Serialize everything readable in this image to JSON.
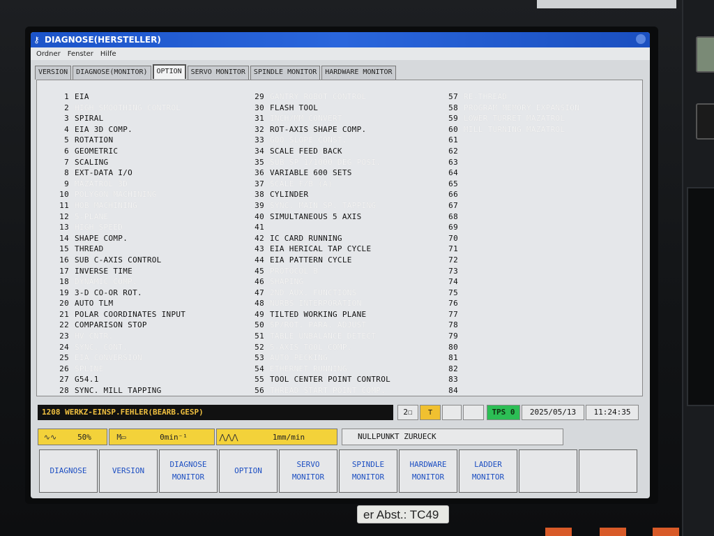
{
  "window": {
    "title": "DIAGNOSE(HERSTELLER)",
    "menu": [
      "Ordner",
      "Fenster",
      "Hilfe"
    ]
  },
  "tabs": [
    {
      "label": "VERSION",
      "active": false
    },
    {
      "label": "DIAGNOSE(MONITOR)",
      "active": false
    },
    {
      "label": "OPTION",
      "active": true
    },
    {
      "label": "SERVO MONITOR",
      "active": false
    },
    {
      "label": "SPINDLE MONITOR",
      "active": false
    },
    {
      "label": "HARDWARE MONITOR",
      "active": false
    }
  ],
  "options": {
    "col1": [
      {
        "n": "1",
        "name": "EIA",
        "on": true
      },
      {
        "n": "2",
        "name": "HIGH SMOOTHING CONTROL",
        "on": false
      },
      {
        "n": "3",
        "name": "SPIRAL",
        "on": true
      },
      {
        "n": "4",
        "name": "EIA 3D COMP.",
        "on": true
      },
      {
        "n": "5",
        "name": "ROTATION",
        "on": true
      },
      {
        "n": "6",
        "name": "GEOMETRIC",
        "on": true
      },
      {
        "n": "7",
        "name": "SCALING",
        "on": true
      },
      {
        "n": "8",
        "name": "EXT-DATA I/O",
        "on": true
      },
      {
        "n": "9",
        "name": "MAZATROL 3D",
        "on": false
      },
      {
        "n": "10",
        "name": "POLYGON MACHINING",
        "on": false
      },
      {
        "n": "11",
        "name": "HOB MACHINING",
        "on": false
      },
      {
        "n": "12",
        "name": "5-PLANE",
        "on": false
      },
      {
        "n": "13",
        "name": "HIGH SPEED",
        "on": false
      },
      {
        "n": "14",
        "name": "SHAPE COMP.",
        "on": true
      },
      {
        "n": "15",
        "name": "THREAD",
        "on": true
      },
      {
        "n": "16",
        "name": "SUB C-AXIS CONTROL",
        "on": true
      },
      {
        "n": "17",
        "name": "INVERSE TIME",
        "on": true
      },
      {
        "n": "18",
        "name": "DYNAMIC COMP.",
        "on": false
      },
      {
        "n": "19",
        "name": "3-D CO-OR ROT.",
        "on": true
      },
      {
        "n": "20",
        "name": "AUTO TLM",
        "on": true
      },
      {
        "n": "21",
        "name": "POLAR COORDINATES INPUT",
        "on": true
      },
      {
        "n": "22",
        "name": "COMPARISON STOP",
        "on": true
      },
      {
        "n": "23",
        "name": "HV CNTR.",
        "on": false
      },
      {
        "n": "24",
        "name": "SYNC. CONT.",
        "on": false
      },
      {
        "n": "25",
        "name": "EIA CONVERSION",
        "on": false
      },
      {
        "n": "26",
        "name": "SPLINE",
        "on": false
      },
      {
        "n": "27",
        "name": "G54.1",
        "on": true
      },
      {
        "n": "28",
        "name": "SYNC. MILL TAPPING",
        "on": true
      }
    ],
    "col2": [
      {
        "n": "29",
        "name": "GANTRY ROBOT CONTROL",
        "on": false
      },
      {
        "n": "30",
        "name": "FLASH TOOL",
        "on": true
      },
      {
        "n": "31",
        "name": "INCH/MM CONVERT",
        "on": false
      },
      {
        "n": "32",
        "name": "ROT-AXIS SHAPE COMP.",
        "on": true
      },
      {
        "n": "33",
        "name": "G00 SLOPE CONST.",
        "on": false
      },
      {
        "n": "34",
        "name": "SCALE FEED BACK",
        "on": true
      },
      {
        "n": "35",
        "name": "SUB SP 1/1000 DEG POSI.",
        "on": false
      },
      {
        "n": "36",
        "name": "VARIABLE 600 SETS",
        "on": true
      },
      {
        "n": "37",
        "name": "SCALE F/B (A)",
        "on": false
      },
      {
        "n": "38",
        "name": "CYLINDER",
        "on": true
      },
      {
        "n": "39",
        "name": "SYNC. MAIN SP. TAPPING",
        "on": false
      },
      {
        "n": "40",
        "name": "SIMULTANEOUS 5 AXIS",
        "on": true
      },
      {
        "n": "41",
        "name": "",
        "on": true
      },
      {
        "n": "42",
        "name": "IC CARD RUNNING",
        "on": true
      },
      {
        "n": "43",
        "name": "EIA HERICAL TAP CYCLE",
        "on": true
      },
      {
        "n": "44",
        "name": "EIA PATTERN CYCLE",
        "on": true
      },
      {
        "n": "45",
        "name": "PROTOCOL B",
        "on": false
      },
      {
        "n": "46",
        "name": "SHAPING",
        "on": false
      },
      {
        "n": "47",
        "name": "2ND AUX. FUNCTIONS",
        "on": false
      },
      {
        "n": "48",
        "name": "NURBS INTERPORATION",
        "on": false
      },
      {
        "n": "49",
        "name": "TILTED WORKING PLANE",
        "on": true
      },
      {
        "n": "50",
        "name": "SP/ROT. PARA. ADJUST",
        "on": false
      },
      {
        "n": "51",
        "name": "TABLE UNBALANCE DETECT",
        "on": false
      },
      {
        "n": "52",
        "name": "5-AXIS TOOL COMP.",
        "on": false
      },
      {
        "n": "53",
        "name": "AUTO PECKING",
        "on": false
      },
      {
        "n": "54",
        "name": "ETHERNET RUNNING",
        "on": false
      },
      {
        "n": "55",
        "name": "TOOL CENTER POINT CONTROL",
        "on": true
      },
      {
        "n": "56",
        "name": "THREAD START POINT COMP.",
        "on": false
      }
    ],
    "col3": [
      {
        "n": "57",
        "name": "RE-THREAD",
        "on": false
      },
      {
        "n": "58",
        "name": "PROGRAM MEMORY EXPANSION",
        "on": false
      },
      {
        "n": "59",
        "name": "LOWER TURRET MAZATROL",
        "on": false
      },
      {
        "n": "60",
        "name": "MILL TURNING MAZATROL",
        "on": false
      },
      {
        "n": "61",
        "name": "",
        "on": true
      },
      {
        "n": "62",
        "name": "",
        "on": true
      },
      {
        "n": "63",
        "name": "",
        "on": true
      },
      {
        "n": "64",
        "name": "",
        "on": true
      },
      {
        "n": "65",
        "name": "",
        "on": true
      },
      {
        "n": "66",
        "name": "",
        "on": true
      },
      {
        "n": "67",
        "name": "",
        "on": true
      },
      {
        "n": "68",
        "name": "",
        "on": true
      },
      {
        "n": "69",
        "name": "",
        "on": true
      },
      {
        "n": "70",
        "name": "",
        "on": true
      },
      {
        "n": "71",
        "name": "",
        "on": true
      },
      {
        "n": "72",
        "name": "",
        "on": true
      },
      {
        "n": "73",
        "name": "",
        "on": true
      },
      {
        "n": "74",
        "name": "",
        "on": true
      },
      {
        "n": "75",
        "name": "",
        "on": true
      },
      {
        "n": "76",
        "name": "",
        "on": true
      },
      {
        "n": "77",
        "name": "",
        "on": true
      },
      {
        "n": "78",
        "name": "",
        "on": true
      },
      {
        "n": "79",
        "name": "",
        "on": true
      },
      {
        "n": "80",
        "name": "",
        "on": true
      },
      {
        "n": "81",
        "name": "",
        "on": true
      },
      {
        "n": "82",
        "name": "",
        "on": true
      },
      {
        "n": "83",
        "name": "",
        "on": true
      },
      {
        "n": "84",
        "name": "",
        "on": true
      }
    ]
  },
  "status": {
    "alarm": "1208 WERKZ-EINSP.FEHLER(BEARB.GESP)",
    "icon1": "2☐",
    "tps": "TPS 0",
    "date": "2025/05/13",
    "time": "11:24:35",
    "spindle_override": "50%",
    "spindle_speed": "0min⁻¹",
    "feed": "1mm/min",
    "message": "NULLPUNKT ZURUECK"
  },
  "softkeys": [
    [
      "DIAGNOSE"
    ],
    [
      "VERSION"
    ],
    [
      "DIAGNOSE",
      "MONITOR"
    ],
    [
      "OPTION"
    ],
    [
      "SERVO",
      "MONITOR"
    ],
    [
      "SPINDLE",
      "MONITOR"
    ],
    [
      "HARDWARE",
      "MONITOR"
    ],
    [
      "LADDER",
      "MONITOR"
    ],
    [],
    []
  ],
  "label_tag": "er Abst.: TC49",
  "colors": {
    "titlebar": "#2a66dc",
    "gauge": "#f3d23a",
    "tps": "#2cbe55",
    "softkey_text": "#1d4fc2",
    "alarm_text": "#f0c040"
  }
}
